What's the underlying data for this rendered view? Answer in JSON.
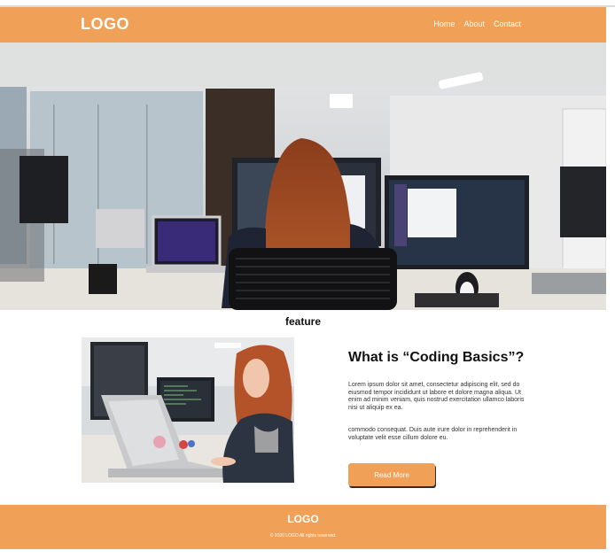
{
  "header": {
    "logo": "LOGO",
    "nav": [
      "Home",
      "About",
      "Contact"
    ]
  },
  "section": {
    "title": "feature"
  },
  "feature": {
    "heading": "What is “Coding Basics”?",
    "paragraph1": "Lorem ipsum dolor sit amet, consectetur adipiscing elit, sed do eiusmod tempor incididunt ut labore et dolore magna aliqua. Ut enim ad minim veniam, quis nostrud exercitation ullamco laboris nisi ut aliquip ex ea.",
    "paragraph2": "commodo consequat. Duis aute irure dolor in reprehenderit in voluptate velit esse cillum dolore eu.",
    "button": "Read More"
  },
  "footer": {
    "logo": "LOGO",
    "copyright": "© 2020 LOGO All rights reserved."
  },
  "colors": {
    "accent": "#f0a057"
  }
}
